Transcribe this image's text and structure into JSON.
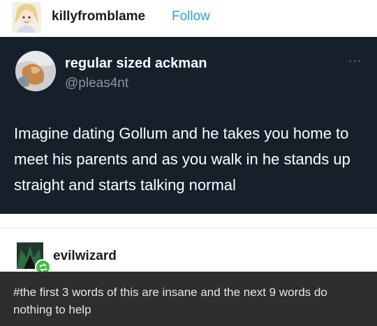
{
  "header": {
    "username": "killyfromblame",
    "follow_label": "Follow"
  },
  "tweet": {
    "display_name": "regular sized ackman",
    "handle": "@pleas4nt",
    "more_label": "···",
    "text": "Imagine dating Gollum and he takes you home to meet his parents and as you walk in he stands up straight and starts talking normal"
  },
  "reblog": {
    "username": "evilwizard",
    "badge_icon": "reblog-icon"
  },
  "comment": {
    "text": "#the first 3 words of this are insane and the next 9 words do nothing to help"
  },
  "colors": {
    "tweet_bg": "#15202b",
    "follow": "#2aa0d8",
    "comment_bg": "#2e2e2e",
    "badge": "#3fbf4a"
  }
}
